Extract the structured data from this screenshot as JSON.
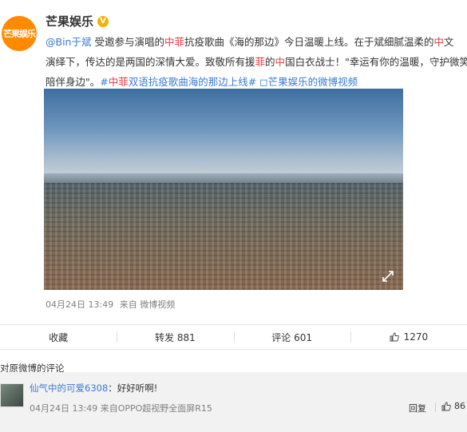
{
  "post": {
    "author": "芒果娱乐",
    "avatar_text": "芒果娱乐",
    "verified_mark": "V",
    "line1": {
      "mention": "@Bin于斌",
      "t1": " 受邀参与演唱的",
      "r1": "中菲",
      "t2": "抗疫歌曲《海的那边》今日温暖上线。在于斌细腻温柔的",
      "r2": "中",
      "t3": "文"
    },
    "line2": {
      "t1": "演绎下，传达的是两国的深情大爱。致敬所有援",
      "r1": "菲",
      "t2": "的",
      "r2": "中",
      "t3": "国白衣战士！\"幸运有你的温暖，守护微笑"
    },
    "line3": {
      "t1": "陪伴身边\"。",
      "hashtag_pre": "#",
      "hashtag_red": "中菲",
      "hashtag_rest": "双语抗疫歌曲海的那边上线#",
      "video_link": " ◻芒果娱乐的微博视频"
    },
    "timestamp": "04月24日 13:49",
    "source": "来自 微博视频"
  },
  "actions": {
    "favorite": "收藏",
    "repost": "转发 881",
    "comment": "评论 601",
    "like": "1270"
  },
  "comments": {
    "header": "对原微博的评论",
    "items": [
      {
        "username": "仙气中的可爱6308",
        "text": "：好好听啊!",
        "time": "04月24日 13:49",
        "source": "来自OPPO超视野全面屏R15",
        "reply_label": "回复",
        "likes": "86"
      }
    ]
  }
}
